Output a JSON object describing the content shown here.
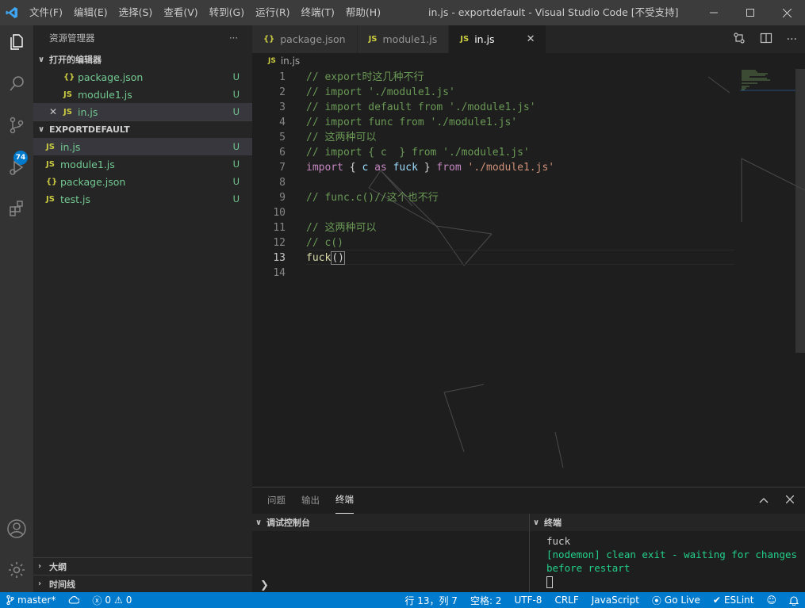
{
  "titlebar": {
    "menu": [
      "文件(F)",
      "编辑(E)",
      "选择(S)",
      "查看(V)",
      "转到(G)",
      "运行(R)",
      "终端(T)",
      "帮助(H)"
    ],
    "title": "in.js - exportdefault - Visual Studio Code [不受支持]",
    "window_buttons": [
      "minimize-icon",
      "maximize-icon",
      "close-icon"
    ]
  },
  "activitybar": {
    "icons": [
      "explorer-icon",
      "search-icon",
      "source-control-icon",
      "run-debug-icon",
      "extensions-icon",
      "account-icon",
      "settings-gear-icon"
    ],
    "scm_badge": "74"
  },
  "sidebar": {
    "title": "资源管理器",
    "more": "···",
    "open_editors": {
      "header": "打开的编辑器",
      "items": [
        {
          "icon": "{}",
          "name": "package.json",
          "status": "U"
        },
        {
          "icon": "JS",
          "name": "module1.js",
          "status": "U"
        },
        {
          "icon": "JS",
          "name": "in.js",
          "status": "U"
        }
      ]
    },
    "workspace": {
      "header": "EXPORTDEFAULT",
      "items": [
        {
          "icon": "JS",
          "name": "in.js",
          "status": "U"
        },
        {
          "icon": "JS",
          "name": "module1.js",
          "status": "U"
        },
        {
          "icon": "{}",
          "name": "package.json",
          "status": "U"
        },
        {
          "icon": "JS",
          "name": "test.js",
          "status": "U"
        }
      ]
    },
    "outline": "大纲",
    "timeline": "时间线"
  },
  "tabs": [
    {
      "icon": "{}",
      "label": "package.json"
    },
    {
      "icon": "JS",
      "label": "module1.js"
    },
    {
      "icon": "JS",
      "label": "in.js",
      "close": "✕"
    }
  ],
  "breadcrumb": {
    "icon": "JS",
    "file": "in.js"
  },
  "code": {
    "lines": [
      {
        "n": "1",
        "parts": [
          {
            "t": "// export时这几种不行",
            "c": "comment"
          }
        ]
      },
      {
        "n": "2",
        "parts": [
          {
            "t": "// import './module1.js'",
            "c": "comment"
          }
        ]
      },
      {
        "n": "3",
        "parts": [
          {
            "t": "// import default from './module1.js'",
            "c": "comment"
          }
        ]
      },
      {
        "n": "4",
        "parts": [
          {
            "t": "// import func from './module1.js'",
            "c": "comment"
          }
        ]
      },
      {
        "n": "5",
        "parts": [
          {
            "t": "// 这两种可以",
            "c": "comment"
          }
        ]
      },
      {
        "n": "6",
        "parts": [
          {
            "t": "// import { c  } from './module1.js'",
            "c": "comment"
          }
        ]
      },
      {
        "n": "7",
        "parts": [
          {
            "t": "import",
            "c": "kw"
          },
          {
            "t": " { ",
            "c": "punc"
          },
          {
            "t": "c",
            "c": "var"
          },
          {
            "t": " ",
            "c": "punc"
          },
          {
            "t": "as",
            "c": "kw"
          },
          {
            "t": " ",
            "c": "punc"
          },
          {
            "t": "fuck",
            "c": "var"
          },
          {
            "t": " } ",
            "c": "punc"
          },
          {
            "t": "from",
            "c": "kw"
          },
          {
            "t": " ",
            "c": "punc"
          },
          {
            "t": "'./module1.js'",
            "c": "str"
          }
        ]
      },
      {
        "n": "8",
        "parts": []
      },
      {
        "n": "9",
        "parts": [
          {
            "t": "// func.c()//这个也不行",
            "c": "comment"
          }
        ]
      },
      {
        "n": "10",
        "parts": []
      },
      {
        "n": "11",
        "parts": [
          {
            "t": "// 这两种可以",
            "c": "comment"
          }
        ]
      },
      {
        "n": "12",
        "parts": [
          {
            "t": "// c()",
            "c": "comment"
          }
        ]
      },
      {
        "n": "13",
        "parts": [
          {
            "t": "fuck",
            "c": "fn"
          },
          {
            "t": "()",
            "c": "punc"
          }
        ]
      },
      {
        "n": "14",
        "parts": []
      }
    ],
    "current_line": "13"
  },
  "panel": {
    "tabs": [
      "问题",
      "输出",
      "终端"
    ],
    "active_tab": "终端",
    "debug_console_header": "调试控制台",
    "terminal_header": "终端",
    "terminal_lines": [
      "fuck"
    ],
    "terminal_green": "[nodemon] clean exit - waiting for changes before restart",
    "prompt": "❯"
  },
  "statusbar": {
    "branch": "master*",
    "errors": "0",
    "warnings": "0",
    "position": "行 13，列 7",
    "spaces": "空格: 2",
    "encoding": "UTF-8",
    "eol": "CRLF",
    "language": "JavaScript",
    "golive": "Go Live",
    "eslint": "ESLint"
  },
  "colors": {
    "accent": "#007acc",
    "untracked": "#73c991",
    "comment": "#6a9955",
    "keyword": "#c586c0",
    "string": "#ce9178"
  }
}
